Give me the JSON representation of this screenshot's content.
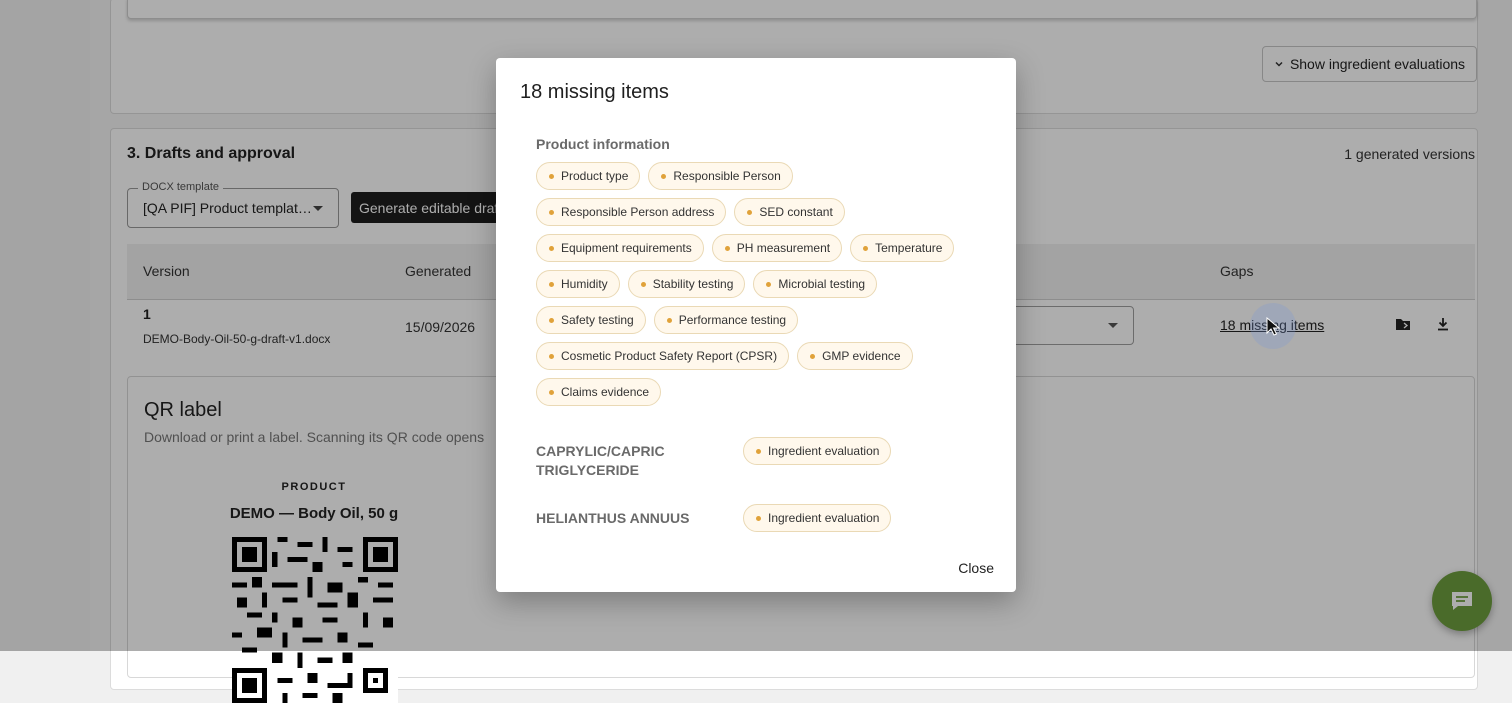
{
  "top_section": {
    "show_evaluations_label": "Show ingredient evaluations"
  },
  "drafts": {
    "title": "3. Drafts and approval",
    "generated_versions": "1 generated versions",
    "template_legend": "DOCX template",
    "template_value": "[QA PIF] Product templat…",
    "generate_label": "Generate editable draft",
    "columns": {
      "version": "Version",
      "generated": "Generated",
      "gaps": "Gaps"
    },
    "row": {
      "version": "1",
      "file": "DEMO-Body-Oil-50-g-draft-v1.docx",
      "date": "15/09/2026",
      "gaps": "18 missing items"
    }
  },
  "qr": {
    "title": "QR label",
    "subtitle": "Download or print a label. Scanning its QR code opens",
    "product_caption": "PRODUCT",
    "product_name": "DEMO — Body Oil, 50 g"
  },
  "modal": {
    "title": "18 missing items",
    "group_label": "Product information",
    "items": [
      "Product type",
      "Responsible Person",
      "Responsible Person address",
      "SED constant",
      "Equipment requirements",
      "PH measurement",
      "Temperature",
      "Humidity",
      "Stability testing",
      "Microbial testing",
      "Safety testing",
      "Performance testing",
      "Cosmetic Product Safety Report (CPSR)",
      "GMP evidence",
      "Claims evidence"
    ],
    "ingredients": [
      {
        "name": "CAPRYLIC/CAPRIC TRIGLYCERIDE",
        "item": "Ingredient evaluation"
      },
      {
        "name": "HELIANTHUS ANNUUS",
        "item": "Ingredient evaluation"
      }
    ],
    "close_label": "Close"
  },
  "icons": {
    "chevron": "chevron-down-icon",
    "folder": "folder-icon",
    "download": "download-icon",
    "chat": "chat-icon",
    "dot_color": "#e0a23a",
    "chat_color": "#6e9e3e"
  }
}
